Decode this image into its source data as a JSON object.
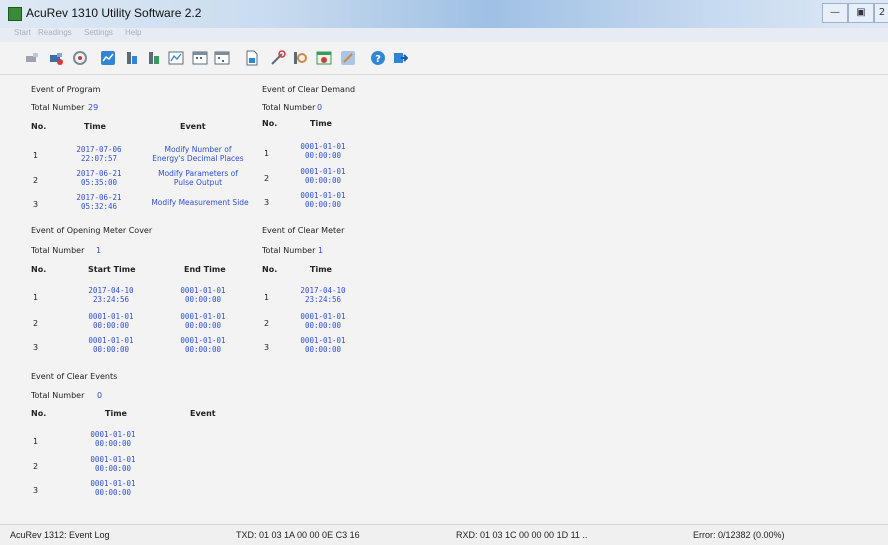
{
  "window": {
    "title": "AcuRev 1310 Utility Software 2.2",
    "controls": {
      "minimize": "—",
      "maximize": "▣",
      "extra": "2"
    }
  },
  "menu": [
    "Start",
    "Readings",
    "Settings",
    "Help"
  ],
  "toolbar_icons": [
    "disconnect-icon",
    "connect-icon",
    "refresh-icon",
    "readings-icon",
    "meter-icon",
    "meter-alt-icon",
    "chart-icon",
    "calendar-icon",
    "calendar-alt-icon",
    "document-icon",
    "tools-icon",
    "counter-icon",
    "event-icon",
    "export-icon",
    "help-icon",
    "exit-icon"
  ],
  "program_events": {
    "title": "Event of Program",
    "total_label": "Total Number",
    "total": "29",
    "headers": {
      "no": "No.",
      "time": "Time",
      "event": "Event"
    },
    "rows": [
      {
        "no": "1",
        "date": "2017-07-06",
        "time": "22:07:57",
        "event1": "Modify Number of",
        "event2": "Energy's Decimal Places"
      },
      {
        "no": "2",
        "date": "2017-06-21",
        "time": "05:35:00",
        "event1": "Modify Parameters of",
        "event2": "Pulse Output"
      },
      {
        "no": "3",
        "date": "2017-06-21",
        "time": "05:32:46",
        "event1": "Modify Measurement Side",
        "event2": ""
      }
    ]
  },
  "clear_demand": {
    "title": "Event of Clear Demand",
    "total_label": "Total Number",
    "total": "0",
    "headers": {
      "no": "No.",
      "time": "Time"
    },
    "rows": [
      {
        "no": "1",
        "date": "0001-01-01",
        "time": "00:00:00"
      },
      {
        "no": "2",
        "date": "0001-01-01",
        "time": "00:00:00"
      },
      {
        "no": "3",
        "date": "0001-01-01",
        "time": "00:00:00"
      }
    ]
  },
  "cover_events": {
    "title": "Event of Opening Meter Cover",
    "total_label": "Total Number",
    "total": "1",
    "headers": {
      "no": "No.",
      "start": "Start Time",
      "end": "End Time"
    },
    "rows": [
      {
        "no": "1",
        "sdate": "2017-04-10",
        "stime": "23:24:56",
        "edate": "0001-01-01",
        "etime": "00:00:00"
      },
      {
        "no": "2",
        "sdate": "0001-01-01",
        "stime": "00:00:00",
        "edate": "0001-01-01",
        "etime": "00:00:00"
      },
      {
        "no": "3",
        "sdate": "0001-01-01",
        "stime": "00:00:00",
        "edate": "0001-01-01",
        "etime": "00:00:00"
      }
    ]
  },
  "clear_meter": {
    "title": "Event of Clear Meter",
    "total_label": "Total Number",
    "total": "1",
    "headers": {
      "no": "No.",
      "time": "Time"
    },
    "rows": [
      {
        "no": "1",
        "date": "2017-04-10",
        "time": "23:24:56"
      },
      {
        "no": "2",
        "date": "0001-01-01",
        "time": "00:00:00"
      },
      {
        "no": "3",
        "date": "0001-01-01",
        "time": "00:00:00"
      }
    ]
  },
  "clear_events": {
    "title": "Event of Clear Events",
    "total_label": "Total Number",
    "total": "0",
    "headers": {
      "no": "No.",
      "time": "Time",
      "event": "Event"
    },
    "rows": [
      {
        "no": "1",
        "date": "0001-01-01",
        "time": "00:00:00"
      },
      {
        "no": "2",
        "date": "0001-01-01",
        "time": "00:00:00"
      },
      {
        "no": "3",
        "date": "0001-01-01",
        "time": "00:00:00"
      }
    ]
  },
  "status": {
    "device": "AcuRev 1312: Event Log",
    "txd": "TXD: 01 03 1A 00 00 0E C3 16",
    "rxd": "RXD: 01 03 1C 00 00 00 1D 11 ..",
    "error": "Error: 0/12382  (0.00%)"
  }
}
